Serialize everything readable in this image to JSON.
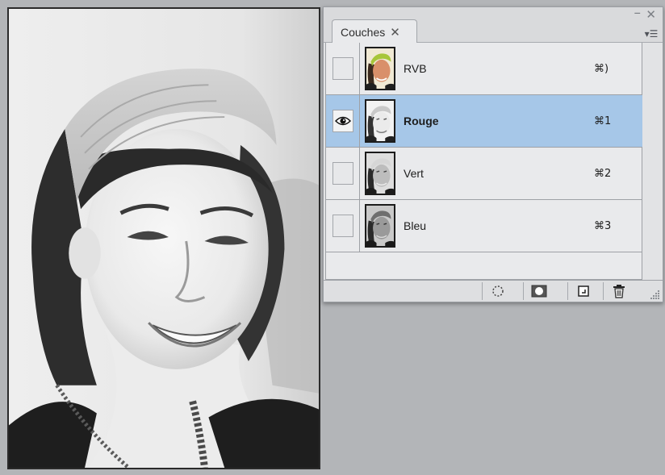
{
  "panel": {
    "minimize_glyph": "–",
    "close_glyph": "✕",
    "tab": {
      "label": "Couches",
      "close_glyph": "✕"
    },
    "menu_glyph": "▾☰"
  },
  "channels": [
    {
      "name": "RVB",
      "shortcut": "⌘)",
      "visible": false,
      "selected": false,
      "thumb_style": "color"
    },
    {
      "name": "Rouge",
      "shortcut": "⌘1",
      "visible": true,
      "selected": true,
      "thumb_style": "light-gray"
    },
    {
      "name": "Vert",
      "shortcut": "⌘2",
      "visible": false,
      "selected": false,
      "thumb_style": "gray"
    },
    {
      "name": "Bleu",
      "shortcut": "⌘3",
      "visible": false,
      "selected": false,
      "thumb_style": "dark-gray"
    }
  ],
  "bottom_buttons": [
    {
      "name": "load-channel-as-selection-button",
      "icon": "dotted-circle-icon"
    },
    {
      "name": "save-selection-as-channel-button",
      "icon": "mask-icon"
    },
    {
      "name": "new-channel-button",
      "icon": "new-page-icon"
    },
    {
      "name": "delete-channel-button",
      "icon": "trash-icon"
    }
  ],
  "colors": {
    "selected_row": "#a6c7e8",
    "desktop": "#b3b5b8",
    "panel": "#e2e3e5"
  }
}
